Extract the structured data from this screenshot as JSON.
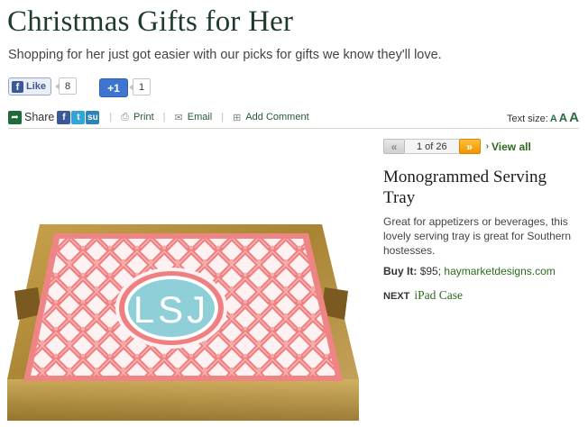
{
  "header": {
    "title": "Christmas Gifts for Her",
    "subtitle": "Shopping for her just got easier with our picks for gifts we know they'll love."
  },
  "social": {
    "like_label": "Like",
    "like_count": "8",
    "plusone_label": "+1",
    "plusone_count": "1"
  },
  "toolbar": {
    "share_label": "Share",
    "print_label": "Print",
    "email_label": "Email",
    "comment_label": "Add Comment",
    "text_size_label": "Text size:",
    "size_options": [
      "A",
      "A",
      "A"
    ]
  },
  "gallery": {
    "position": "1 of 26",
    "view_all_label": "View all"
  },
  "product": {
    "name": "Monogrammed Serving Tray",
    "description": "Great for appetizers or beverages, this lovely serving tray is great for Southern hostesses.",
    "buy_label": "Buy It:",
    "price": "$95;",
    "store_link": "haymarketdesigns.com",
    "monogram": "LSJ"
  },
  "next": {
    "label": "NEXT",
    "title": "iPad Case"
  },
  "colors": {
    "title_green": "#1f3b2c",
    "link_green": "#2b6b1d",
    "tray_gold": "#b8913f",
    "tray_pink": "#ef7f80",
    "monogram_blue": "#8fcfd8"
  }
}
